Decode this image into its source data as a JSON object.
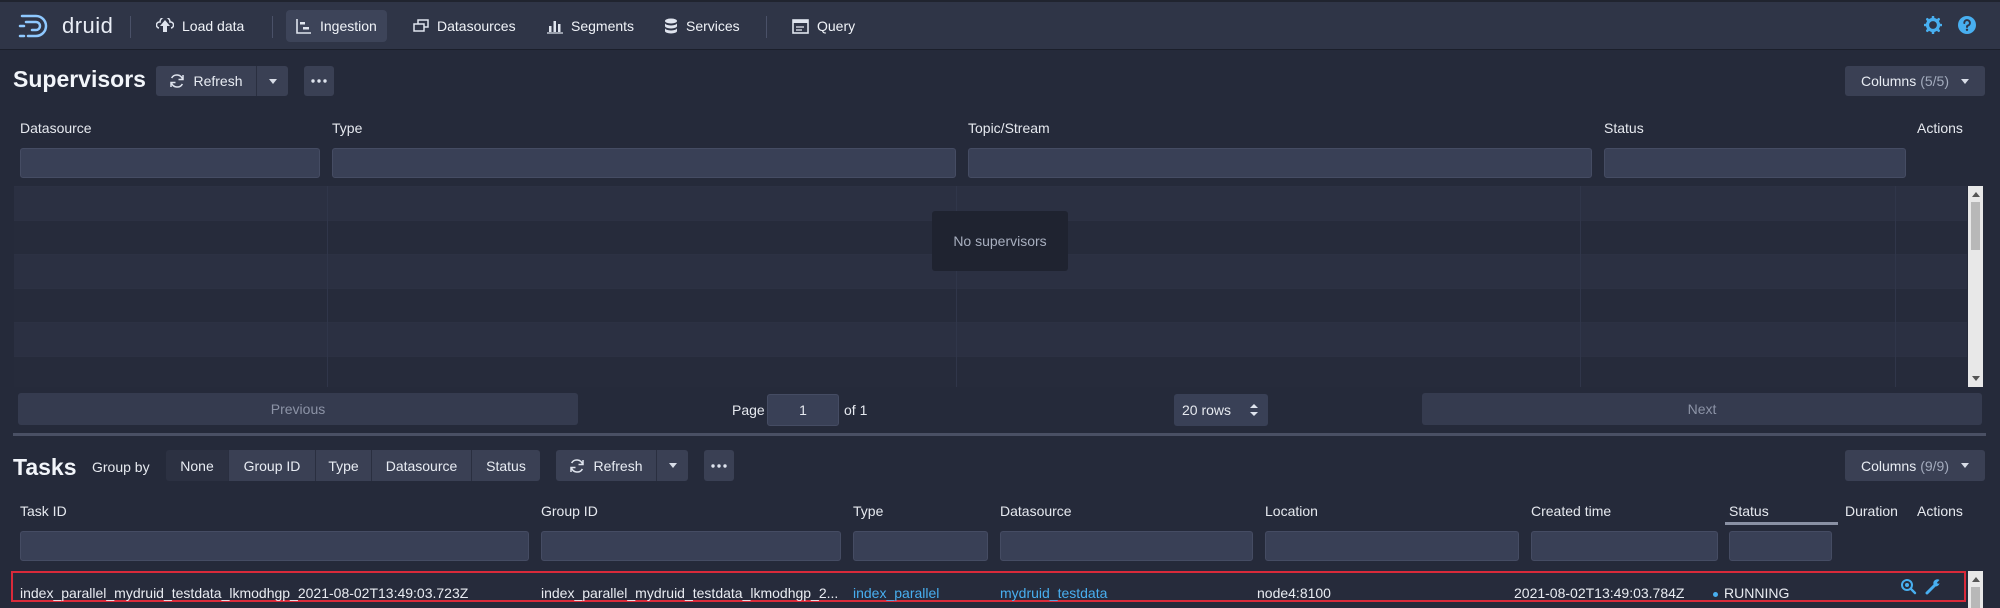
{
  "navbar": {
    "logo_text": "druid",
    "items": [
      {
        "label": "Load data",
        "icon": "cloud-upload-icon"
      },
      {
        "label": "Ingestion",
        "icon": "gantt-chart-icon",
        "active": true
      },
      {
        "label": "Datasources",
        "icon": "multi-select-icon"
      },
      {
        "label": "Segments",
        "icon": "stacked-chart-icon"
      },
      {
        "label": "Services",
        "icon": "database-icon"
      },
      {
        "label": "Query",
        "icon": "application-icon"
      }
    ],
    "right_icons": [
      "gear-icon",
      "help-icon"
    ]
  },
  "supervisors": {
    "title": "Supervisors",
    "refresh_label": "Refresh",
    "columns_label": "Columns",
    "columns_count": "(5/5)",
    "headers": [
      "Datasource",
      "Type",
      "Topic/Stream",
      "Status",
      "Actions"
    ],
    "empty_message": "No supervisors",
    "pagination": {
      "previous": "Previous",
      "page_label": "Page",
      "page_value": "1",
      "of_label": "of 1",
      "rows_select": "20 rows",
      "next": "Next"
    }
  },
  "tasks": {
    "title": "Tasks",
    "group_by_label": "Group by",
    "group_by_options": [
      "None",
      "Group ID",
      "Type",
      "Datasource",
      "Status"
    ],
    "group_by_selected": "None",
    "refresh_label": "Refresh",
    "columns_label": "Columns",
    "columns_count": "(9/9)",
    "headers": [
      "Task ID",
      "Group ID",
      "Type",
      "Datasource",
      "Location",
      "Created time",
      "Status",
      "Duration",
      "Actions"
    ],
    "rows": [
      {
        "task_id": "index_parallel_mydruid_testdata_lkmodhgp_2021-08-02T13:49:03.723Z",
        "group_id": "index_parallel_mydruid_testdata_lkmodhgp_2...",
        "type": "index_parallel",
        "datasource": "mydruid_testdata",
        "location": "node4:8100",
        "created_time": "2021-08-02T13:49:03.784Z",
        "status": "RUNNING",
        "duration": "",
        "actions": [
          "search-icon",
          "wrench-icon"
        ]
      }
    ]
  },
  "colors": {
    "background": "#252a3a",
    "navbar": "#2f3547",
    "link": "#48aff0",
    "highlight_border": "#d92a3a"
  }
}
